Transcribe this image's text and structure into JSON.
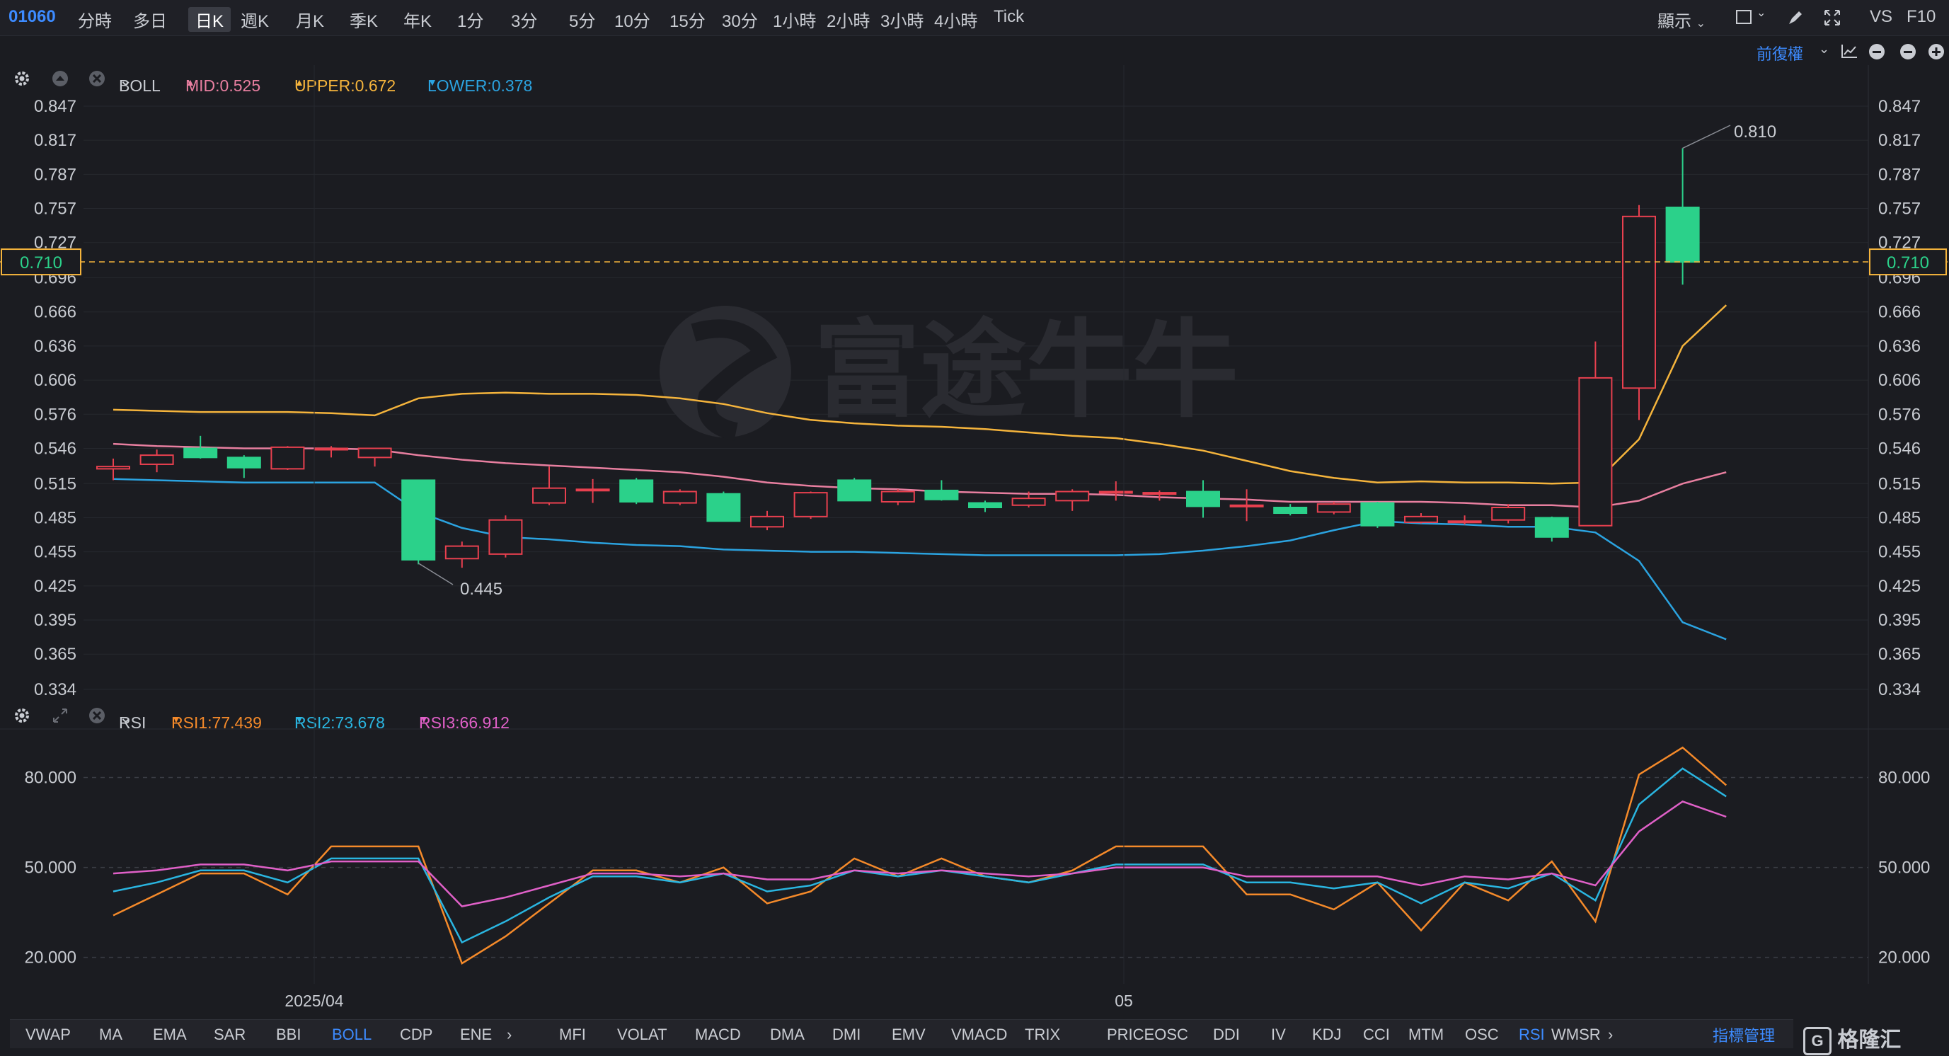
{
  "toolbar": {
    "symbol": "01060",
    "periods": [
      "分時",
      "多日",
      "日K",
      "週K",
      "月K",
      "季K",
      "年K",
      "1分",
      "3分",
      "5分",
      "10分",
      "15分",
      "30分",
      "1小時",
      "2小時",
      "3小時",
      "4小時",
      "Tick"
    ],
    "active_period": "日K",
    "display_label": "顯示",
    "vs_label": "VS",
    "f10_label": "F10"
  },
  "subbar": {
    "adjust_label": "前復權"
  },
  "boll_header": {
    "name": "BOLL",
    "mid": "MID:0.525",
    "upper": "UPPER:0.672",
    "lower": "LOWER:0.378",
    "colors": {
      "mid": "#e87fa0",
      "upper": "#f5b43c",
      "lower": "#2ba3e0"
    }
  },
  "rsi_header": {
    "name": "RSI",
    "rsi1": "RSI1:77.439",
    "rsi2": "RSI2:73.678",
    "rsi3": "RSI3:66.912",
    "colors": {
      "rsi1": "#f58a2a",
      "rsi2": "#2ab5e0",
      "rsi3": "#e060c8"
    }
  },
  "chart_data": [
    {
      "type": "candlestick",
      "y_ticks": [
        "0.847",
        "0.817",
        "0.787",
        "0.757",
        "0.727",
        "0.696",
        "0.666",
        "0.636",
        "0.606",
        "0.576",
        "0.546",
        "0.515",
        "0.485",
        "0.455",
        "0.425",
        "0.395",
        "0.365",
        "0.334"
      ],
      "ylim": [
        0.334,
        0.847
      ],
      "x_labels": [
        "2025/04",
        "05"
      ],
      "current_price": "0.710",
      "annotations": {
        "high": "0.810",
        "low": "0.445"
      },
      "candles": [
        {
          "o": 0.528,
          "h": 0.537,
          "l": 0.518,
          "c": 0.53
        },
        {
          "o": 0.532,
          "h": 0.545,
          "l": 0.525,
          "c": 0.54
        },
        {
          "o": 0.546,
          "h": 0.557,
          "l": 0.537,
          "c": 0.538
        },
        {
          "o": 0.538,
          "h": 0.54,
          "l": 0.52,
          "c": 0.529
        },
        {
          "o": 0.528,
          "h": 0.548,
          "l": 0.527,
          "c": 0.547
        },
        {
          "o": 0.545,
          "h": 0.548,
          "l": 0.538,
          "c": 0.546
        },
        {
          "o": 0.538,
          "h": 0.546,
          "l": 0.53,
          "c": 0.546
        },
        {
          "o": 0.518,
          "h": 0.518,
          "l": 0.444,
          "c": 0.448
        },
        {
          "o": 0.449,
          "h": 0.464,
          "l": 0.441,
          "c": 0.46
        },
        {
          "o": 0.453,
          "h": 0.487,
          "l": 0.45,
          "c": 0.483
        },
        {
          "o": 0.498,
          "h": 0.53,
          "l": 0.496,
          "c": 0.511
        },
        {
          "o": 0.51,
          "h": 0.519,
          "l": 0.498,
          "c": 0.51
        },
        {
          "o": 0.518,
          "h": 0.52,
          "l": 0.497,
          "c": 0.499
        },
        {
          "o": 0.498,
          "h": 0.51,
          "l": 0.496,
          "c": 0.508
        },
        {
          "o": 0.506,
          "h": 0.508,
          "l": 0.482,
          "c": 0.482
        },
        {
          "o": 0.477,
          "h": 0.491,
          "l": 0.474,
          "c": 0.486
        },
        {
          "o": 0.486,
          "h": 0.508,
          "l": 0.484,
          "c": 0.507
        },
        {
          "o": 0.518,
          "h": 0.52,
          "l": 0.5,
          "c": 0.5
        },
        {
          "o": 0.499,
          "h": 0.51,
          "l": 0.496,
          "c": 0.508
        },
        {
          "o": 0.509,
          "h": 0.518,
          "l": 0.5,
          "c": 0.501
        },
        {
          "o": 0.498,
          "h": 0.5,
          "l": 0.49,
          "c": 0.494
        },
        {
          "o": 0.496,
          "h": 0.508,
          "l": 0.494,
          "c": 0.502
        },
        {
          "o": 0.5,
          "h": 0.51,
          "l": 0.491,
          "c": 0.508
        },
        {
          "o": 0.507,
          "h": 0.517,
          "l": 0.5,
          "c": 0.508
        },
        {
          "o": 0.506,
          "h": 0.509,
          "l": 0.5,
          "c": 0.507
        },
        {
          "o": 0.508,
          "h": 0.518,
          "l": 0.485,
          "c": 0.495
        },
        {
          "o": 0.496,
          "h": 0.51,
          "l": 0.482,
          "c": 0.496
        },
        {
          "o": 0.494,
          "h": 0.497,
          "l": 0.487,
          "c": 0.489
        },
        {
          "o": 0.49,
          "h": 0.499,
          "l": 0.488,
          "c": 0.497
        },
        {
          "o": 0.498,
          "h": 0.499,
          "l": 0.476,
          "c": 0.478
        },
        {
          "o": 0.481,
          "h": 0.489,
          "l": 0.48,
          "c": 0.486
        },
        {
          "o": 0.481,
          "h": 0.487,
          "l": 0.479,
          "c": 0.482
        },
        {
          "o": 0.483,
          "h": 0.497,
          "l": 0.48,
          "c": 0.494
        },
        {
          "o": 0.485,
          "h": 0.486,
          "l": 0.464,
          "c": 0.468
        },
        {
          "o": 0.478,
          "h": 0.64,
          "l": 0.478,
          "c": 0.608
        },
        {
          "o": 0.599,
          "h": 0.76,
          "l": 0.571,
          "c": 0.75
        },
        {
          "o": 0.758,
          "h": 0.81,
          "l": 0.69,
          "c": 0.71
        }
      ],
      "series": [
        {
          "name": "UPPER",
          "values": [
            0.58,
            0.579,
            0.578,
            0.578,
            0.578,
            0.577,
            0.575,
            0.59,
            0.594,
            0.595,
            0.594,
            0.594,
            0.593,
            0.59,
            0.585,
            0.577,
            0.571,
            0.568,
            0.566,
            0.565,
            0.563,
            0.56,
            0.557,
            0.555,
            0.55,
            0.544,
            0.535,
            0.526,
            0.52,
            0.516,
            0.517,
            0.516,
            0.516,
            0.515,
            0.516,
            0.554,
            0.636,
            0.672
          ]
        },
        {
          "name": "MID",
          "values": [
            0.55,
            0.548,
            0.547,
            0.546,
            0.546,
            0.546,
            0.545,
            0.54,
            0.536,
            0.533,
            0.531,
            0.529,
            0.527,
            0.525,
            0.521,
            0.516,
            0.513,
            0.511,
            0.51,
            0.508,
            0.507,
            0.506,
            0.506,
            0.505,
            0.503,
            0.502,
            0.501,
            0.499,
            0.499,
            0.499,
            0.499,
            0.498,
            0.496,
            0.496,
            0.494,
            0.5,
            0.515,
            0.525
          ]
        },
        {
          "name": "LOWER",
          "values": [
            0.519,
            0.518,
            0.517,
            0.516,
            0.516,
            0.516,
            0.516,
            0.49,
            0.476,
            0.468,
            0.466,
            0.463,
            0.461,
            0.46,
            0.457,
            0.456,
            0.455,
            0.455,
            0.454,
            0.453,
            0.452,
            0.452,
            0.452,
            0.452,
            0.453,
            0.456,
            0.46,
            0.465,
            0.474,
            0.482,
            0.48,
            0.479,
            0.477,
            0.477,
            0.472,
            0.447,
            0.393,
            0.378
          ]
        }
      ]
    },
    {
      "type": "line",
      "y_ticks": [
        "80.000",
        "50.000",
        "20.000"
      ],
      "ylim": [
        10,
        95
      ],
      "series": [
        {
          "name": "RSI1",
          "values": [
            34,
            41,
            48,
            48,
            41,
            57,
            57,
            57,
            18,
            27,
            38,
            49,
            49,
            45,
            50,
            38,
            42,
            53,
            47,
            53,
            47,
            45,
            49,
            57,
            57,
            57,
            41,
            41,
            36,
            45,
            29,
            45,
            39,
            52,
            32,
            81,
            90,
            77.439
          ]
        },
        {
          "name": "RSI2",
          "values": [
            42,
            45,
            49,
            49,
            45,
            53,
            53,
            53,
            25,
            32,
            40,
            47,
            47,
            45,
            48,
            42,
            44,
            49,
            47,
            49,
            47,
            45,
            48,
            51,
            51,
            51,
            45,
            45,
            43,
            45,
            38,
            45,
            43,
            48,
            39,
            71,
            83,
            73.678
          ]
        },
        {
          "name": "RSI3",
          "values": [
            48,
            49,
            51,
            51,
            49,
            52,
            52,
            52,
            37,
            40,
            44,
            48,
            48,
            47,
            48,
            46,
            46,
            49,
            48,
            49,
            48,
            47,
            48,
            50,
            50,
            50,
            47,
            47,
            47,
            47,
            44,
            47,
            46,
            48,
            44,
            62,
            72,
            66.912
          ]
        }
      ]
    }
  ],
  "bottom_bar": {
    "items": [
      "VWAP",
      "MA",
      "EMA",
      "SAR",
      "BBI",
      "BOLL",
      "CDP",
      "ENE",
      "›",
      "MFI",
      "VOLAT",
      "MACD",
      "DMA",
      "DMI",
      "EMV",
      "VMACD",
      "TRIX",
      "PRICEOSC",
      "DDI",
      "IV",
      "KDJ",
      "CCI",
      "MTM",
      "OSC",
      "RSI",
      "WMSR",
      "›"
    ],
    "active": [
      "BOLL",
      "RSI"
    ],
    "manage_label": "指標管理"
  },
  "watermark": {
    "text": "富途牛牛"
  },
  "brand": {
    "text": "格隆汇"
  }
}
